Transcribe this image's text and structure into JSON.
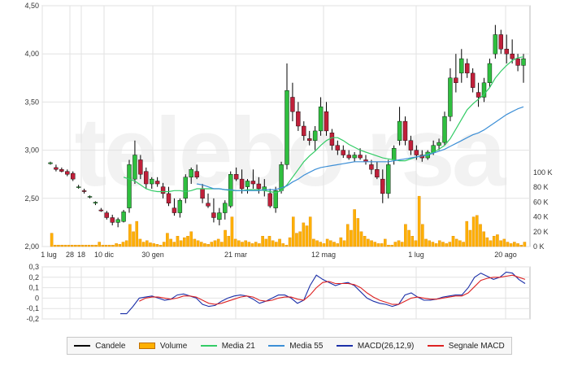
{
  "chart_data": [
    {
      "type": "candlestick",
      "price_axis": {
        "ylim": [
          2.0,
          4.5
        ],
        "ticks": [
          "4,50",
          "4,00",
          "3,50",
          "3,00",
          "2,50",
          "2,00"
        ]
      },
      "volume_axis": {
        "ylim": [
          0,
          100000
        ],
        "ticks": [
          "100 K",
          "80 K",
          "60 K",
          "40 K",
          "20 K",
          "0 K"
        ]
      },
      "x_ticks": [
        "1 lug",
        "28",
        "18",
        "10 dic",
        "30 gen",
        "21 mar",
        "12 mag",
        "1 lug",
        "20 ago"
      ],
      "grid": true,
      "watermark": "telebo rsa",
      "candles": [
        [
          2.86,
          2.88,
          2.85,
          2.87
        ],
        [
          2.82,
          2.85,
          2.78,
          2.8
        ],
        [
          2.8,
          2.82,
          2.77,
          2.78
        ],
        [
          2.78,
          2.8,
          2.73,
          2.75
        ],
        [
          2.76,
          2.78,
          2.68,
          2.7
        ],
        [
          2.62,
          2.64,
          2.6,
          2.62
        ],
        [
          2.58,
          2.6,
          2.55,
          2.57
        ],
        [
          2.52,
          2.53,
          2.5,
          2.52
        ],
        [
          2.45,
          2.47,
          2.43,
          2.46
        ],
        [
          2.38,
          2.4,
          2.36,
          2.37
        ],
        [
          2.35,
          2.37,
          2.28,
          2.3
        ],
        [
          2.3,
          2.33,
          2.22,
          2.25
        ],
        [
          2.25,
          2.3,
          2.2,
          2.28
        ],
        [
          2.26,
          2.38,
          2.25,
          2.36
        ],
        [
          2.4,
          2.9,
          2.35,
          2.85
        ],
        [
          2.7,
          3.1,
          2.65,
          2.95
        ],
        [
          2.9,
          2.95,
          2.7,
          2.75
        ],
        [
          2.78,
          2.82,
          2.6,
          2.65
        ],
        [
          2.65,
          2.72,
          2.6,
          2.7
        ],
        [
          2.68,
          2.72,
          2.62,
          2.65
        ],
        [
          2.62,
          2.66,
          2.5,
          2.55
        ],
        [
          2.55,
          2.62,
          2.42,
          2.45
        ],
        [
          2.4,
          2.5,
          2.32,
          2.35
        ],
        [
          2.35,
          2.5,
          2.3,
          2.48
        ],
        [
          2.5,
          2.75,
          2.45,
          2.72
        ],
        [
          2.72,
          2.82,
          2.65,
          2.8
        ],
        [
          2.78,
          2.85,
          2.7,
          2.72
        ],
        [
          2.6,
          2.65,
          2.45,
          2.5
        ],
        [
          2.45,
          2.55,
          2.4,
          2.42
        ],
        [
          2.35,
          2.5,
          2.25,
          2.3
        ],
        [
          2.28,
          2.4,
          2.22,
          2.35
        ],
        [
          2.35,
          2.48,
          2.28,
          2.45
        ],
        [
          2.42,
          2.78,
          2.4,
          2.75
        ],
        [
          2.75,
          2.82,
          2.68,
          2.7
        ],
        [
          2.7,
          2.8,
          2.55,
          2.6
        ],
        [
          2.62,
          2.7,
          2.55,
          2.68
        ],
        [
          2.68,
          2.8,
          2.6,
          2.65
        ],
        [
          2.65,
          2.72,
          2.55,
          2.6
        ],
        [
          2.58,
          2.7,
          2.52,
          2.62
        ],
        [
          2.55,
          2.6,
          2.4,
          2.42
        ],
        [
          2.4,
          2.62,
          2.35,
          2.58
        ],
        [
          2.58,
          2.88,
          2.55,
          2.85
        ],
        [
          2.85,
          3.9,
          2.8,
          3.62
        ],
        [
          3.55,
          3.7,
          3.3,
          3.4
        ],
        [
          3.4,
          3.5,
          3.2,
          3.25
        ],
        [
          3.25,
          3.3,
          3.1,
          3.15
        ],
        [
          3.12,
          3.2,
          3.05,
          3.1
        ],
        [
          3.1,
          3.25,
          3.0,
          3.2
        ],
        [
          3.2,
          3.55,
          3.15,
          3.45
        ],
        [
          3.4,
          3.5,
          3.15,
          3.2
        ],
        [
          3.18,
          3.22,
          3.0,
          3.05
        ],
        [
          3.05,
          3.1,
          2.95,
          3.0
        ],
        [
          3.0,
          3.05,
          2.92,
          2.95
        ],
        [
          2.95,
          3.0,
          2.9,
          2.92
        ],
        [
          2.92,
          2.98,
          2.88,
          2.95
        ],
        [
          2.95,
          3.02,
          2.9,
          2.92
        ],
        [
          2.9,
          2.95,
          2.85,
          2.88
        ],
        [
          2.85,
          2.9,
          2.75,
          2.8
        ],
        [
          2.8,
          2.88,
          2.7,
          2.72
        ],
        [
          2.7,
          2.8,
          2.45,
          2.55
        ],
        [
          2.55,
          2.9,
          2.5,
          2.85
        ],
        [
          2.9,
          3.05,
          2.85,
          3.02
        ],
        [
          3.1,
          3.45,
          3.05,
          3.3
        ],
        [
          3.3,
          3.35,
          3.05,
          3.1
        ],
        [
          3.1,
          3.15,
          2.95,
          3.0
        ],
        [
          3.0,
          3.05,
          2.9,
          2.95
        ],
        [
          2.95,
          3.0,
          2.88,
          2.92
        ],
        [
          2.92,
          3.0,
          2.9,
          2.98
        ],
        [
          2.98,
          3.1,
          2.95,
          3.05
        ],
        [
          3.05,
          3.12,
          3.0,
          3.08
        ],
        [
          3.08,
          3.4,
          3.05,
          3.35
        ],
        [
          3.35,
          3.85,
          3.3,
          3.75
        ],
        [
          3.75,
          4.0,
          3.6,
          3.7
        ],
        [
          3.8,
          4.05,
          3.7,
          3.95
        ],
        [
          3.9,
          3.95,
          3.75,
          3.8
        ],
        [
          3.8,
          3.85,
          3.6,
          3.65
        ],
        [
          3.6,
          3.7,
          3.45,
          3.55
        ],
        [
          3.55,
          3.75,
          3.5,
          3.7
        ],
        [
          3.7,
          3.95,
          3.65,
          3.9
        ],
        [
          4.0,
          4.3,
          3.95,
          4.2
        ],
        [
          4.2,
          4.25,
          4.0,
          4.05
        ],
        [
          4.05,
          4.2,
          3.9,
          4.0
        ],
        [
          4.0,
          4.15,
          3.9,
          3.95
        ],
        [
          3.95,
          4.0,
          3.82,
          3.88
        ],
        [
          3.88,
          4.0,
          3.7,
          3.95
        ]
      ],
      "volumes": [
        18,
        2,
        2,
        2,
        2,
        2,
        2,
        2,
        2,
        2,
        2,
        2,
        2,
        2,
        6,
        2,
        2,
        2,
        2,
        4,
        3,
        6,
        8,
        30,
        20,
        34,
        10,
        6,
        8,
        5,
        4,
        3,
        2,
        6,
        18,
        10,
        6,
        14,
        8,
        12,
        14,
        20,
        10,
        8,
        6,
        4,
        3,
        6,
        8,
        10,
        6,
        22,
        14,
        40,
        10,
        8,
        6,
        8,
        6,
        4,
        6,
        4,
        14,
        10,
        14,
        8,
        6,
        10,
        4,
        2,
        12,
        40,
        18,
        20,
        32,
        28,
        40,
        10,
        8,
        6,
        4,
        10,
        8,
        6,
        4,
        12,
        8,
        30,
        22,
        50,
        38,
        20,
        14,
        10,
        8,
        6,
        4,
        4,
        10,
        2,
        2,
        6,
        8,
        6,
        30,
        22,
        14,
        8,
        68,
        30,
        10,
        8,
        6,
        4,
        8,
        6,
        4,
        6,
        14,
        10,
        8,
        6,
        34,
        22,
        40,
        42,
        30,
        20,
        12,
        8,
        14,
        16,
        8,
        10,
        6,
        4,
        6,
        4,
        2,
        6
      ],
      "series": [
        {
          "name": "Media 21",
          "color": "#33cc66",
          "values": [
            null,
            null,
            null,
            null,
            null,
            null,
            null,
            null,
            null,
            null,
            null,
            null,
            null,
            2.72,
            2.7,
            2.68,
            2.64,
            2.6,
            2.58,
            2.57,
            2.57,
            2.57,
            2.58,
            2.58,
            2.57,
            2.58,
            2.6,
            2.6,
            2.6,
            2.6,
            2.6,
            2.59,
            2.58,
            2.58,
            2.58,
            2.59,
            2.59,
            2.59,
            2.58,
            2.57,
            2.56,
            2.58,
            2.64,
            2.72,
            2.8,
            2.88,
            2.94,
            2.99,
            3.05,
            3.1,
            3.13,
            3.13,
            3.1,
            3.06,
            3.03,
            3.0,
            2.98,
            2.96,
            2.94,
            2.92,
            2.91,
            2.9,
            2.89,
            2.89,
            2.91,
            2.93,
            2.94,
            2.96,
            2.98,
            3.01,
            3.05,
            3.12,
            3.22,
            3.32,
            3.42,
            3.48,
            3.53,
            3.58,
            3.65,
            3.75,
            3.82,
            3.88,
            3.93,
            3.96,
            3.97
          ]
        },
        {
          "name": "Media 55",
          "color": "#3d8fd6",
          "values": [
            null,
            null,
            null,
            null,
            null,
            null,
            null,
            null,
            null,
            null,
            null,
            null,
            null,
            null,
            null,
            null,
            null,
            null,
            null,
            null,
            null,
            null,
            null,
            null,
            null,
            null,
            2.65,
            2.64,
            2.62,
            2.6,
            2.6,
            2.59,
            2.59,
            2.58,
            2.58,
            2.58,
            2.58,
            2.58,
            2.59,
            2.59,
            2.59,
            2.61,
            2.63,
            2.67,
            2.7,
            2.74,
            2.77,
            2.8,
            2.82,
            2.83,
            2.84,
            2.85,
            2.86,
            2.87,
            2.88,
            2.88,
            2.88,
            2.88,
            2.88,
            2.88,
            2.88,
            2.89,
            2.9,
            2.91,
            2.92,
            2.93,
            2.94,
            2.95,
            2.97,
            2.99,
            3.01,
            3.04,
            3.07,
            3.1,
            3.13,
            3.16,
            3.18,
            3.21,
            3.25,
            3.29,
            3.33,
            3.37,
            3.4,
            3.43,
            3.45
          ]
        }
      ]
    },
    {
      "type": "line",
      "ylim": [
        -0.2,
        0.3
      ],
      "ticks": [
        "0,3",
        "0,2",
        "0,1",
        "0",
        "-0,1",
        "-0,2"
      ],
      "series": [
        {
          "name": "MACD(26,12,9)",
          "color": "#1b2fa8",
          "values": [
            -0.15,
            -0.15,
            -0.08,
            0.0,
            0.01,
            0.02,
            0.0,
            -0.02,
            -0.01,
            0.03,
            0.04,
            0.02,
            0.0,
            -0.06,
            -0.08,
            -0.07,
            -0.03,
            0.0,
            0.02,
            0.03,
            0.02,
            -0.01,
            -0.05,
            -0.03,
            0.0,
            0.03,
            0.03,
            0.0,
            -0.05,
            -0.02,
            0.12,
            0.22,
            0.18,
            0.15,
            0.12,
            0.14,
            0.15,
            0.12,
            0.06,
            0.0,
            -0.03,
            -0.05,
            -0.06,
            -0.08,
            -0.06,
            0.03,
            0.05,
            0.01,
            -0.02,
            -0.02,
            -0.01,
            0.01,
            0.02,
            0.03,
            0.03,
            0.1,
            0.2,
            0.24,
            0.21,
            0.18,
            0.2,
            0.25,
            0.24,
            0.18,
            0.14
          ]
        },
        {
          "name": "Segnale MACD",
          "color": "#dd2222",
          "values": [
            null,
            null,
            null,
            -0.03,
            0.0,
            0.01,
            0.01,
            0.0,
            -0.01,
            0.0,
            0.02,
            0.02,
            0.01,
            -0.02,
            -0.05,
            -0.06,
            -0.05,
            -0.03,
            -0.01,
            0.01,
            0.02,
            0.01,
            -0.02,
            -0.03,
            -0.02,
            0.0,
            0.01,
            0.01,
            -0.01,
            -0.02,
            0.03,
            0.1,
            0.15,
            0.16,
            0.14,
            0.14,
            0.14,
            0.13,
            0.1,
            0.05,
            0.01,
            -0.02,
            -0.04,
            -0.06,
            -0.06,
            -0.03,
            0.0,
            0.01,
            0.0,
            -0.01,
            -0.01,
            0.0,
            0.01,
            0.02,
            0.02,
            0.05,
            0.11,
            0.17,
            0.19,
            0.2,
            0.2,
            0.21,
            0.22,
            0.2,
            0.18
          ]
        }
      ]
    }
  ],
  "legend": [
    {
      "key": "candele",
      "label": "Candele",
      "color": "#000000"
    },
    {
      "key": "volume",
      "label": "Volume",
      "color": "#ffb000"
    },
    {
      "key": "media21",
      "label": "Media 21",
      "color": "#33cc66"
    },
    {
      "key": "media55",
      "label": "Media 55",
      "color": "#3d8fd6"
    },
    {
      "key": "macd",
      "label": "MACD(26,12,9)",
      "color": "#1b2fa8"
    },
    {
      "key": "signal",
      "label": "Segnale MACD",
      "color": "#dd2222"
    }
  ]
}
